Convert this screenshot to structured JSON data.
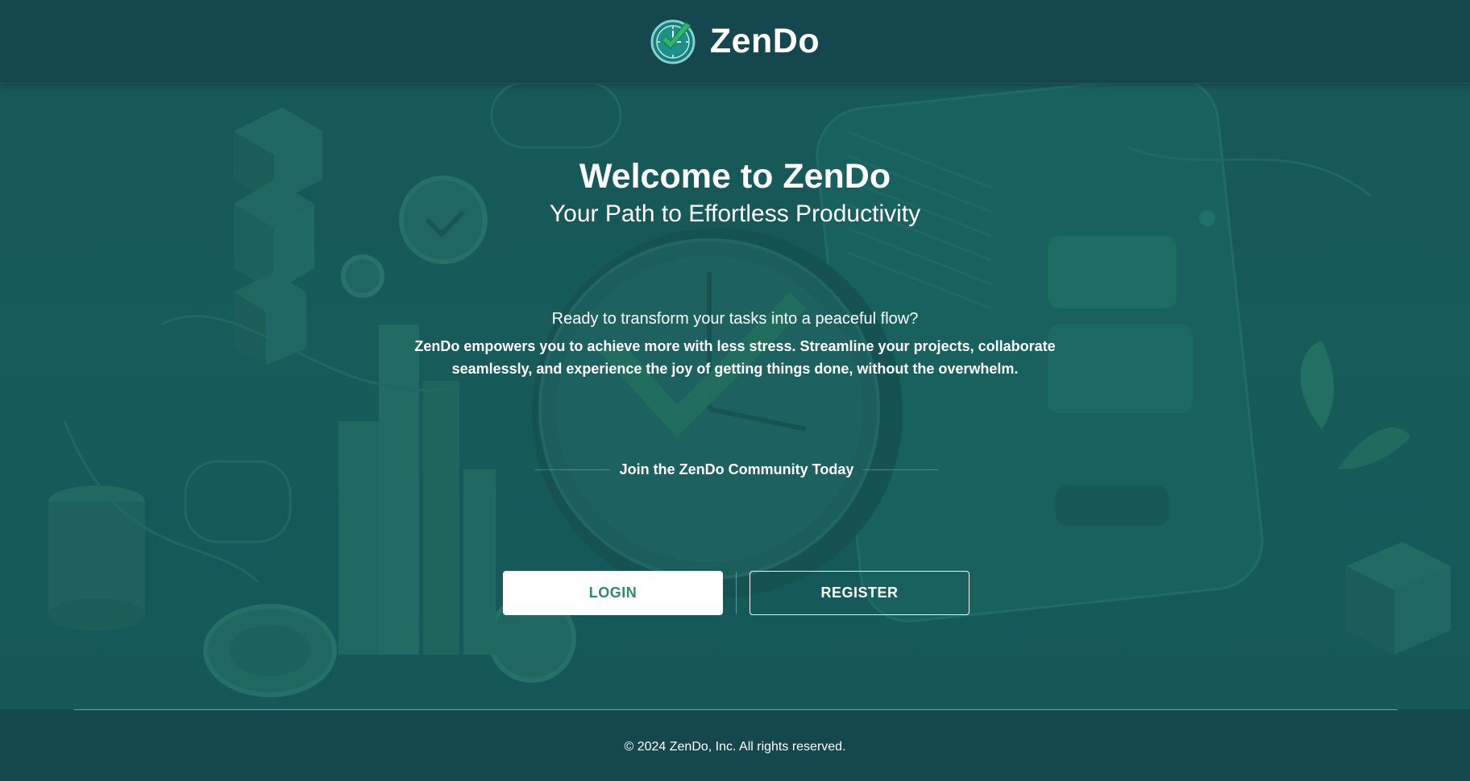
{
  "header": {
    "brand_name": "ZenDo"
  },
  "hero": {
    "title": "Welcome to ZenDo",
    "subtitle": "Your Path to Effortless Productivity",
    "question": "Ready to transform your tasks into a peaceful flow?",
    "description": "ZenDo empowers you to achieve more with less stress. Streamline your projects, collaborate seamlessly, and experience the joy of getting things done, without the overwhelm.",
    "community_label": "Join the ZenDo Community Today"
  },
  "actions": {
    "login_label": "LOGIN",
    "register_label": "REGISTER"
  },
  "footer": {
    "copyright": "© 2024 ZenDo, Inc. All rights reserved."
  },
  "icons": {
    "logo": "clock-check-icon"
  },
  "colors": {
    "header_bg": "#15474f",
    "hero_bg": "#1a6462",
    "accent_green": "#2e8c6a",
    "text": "#ffffff"
  }
}
